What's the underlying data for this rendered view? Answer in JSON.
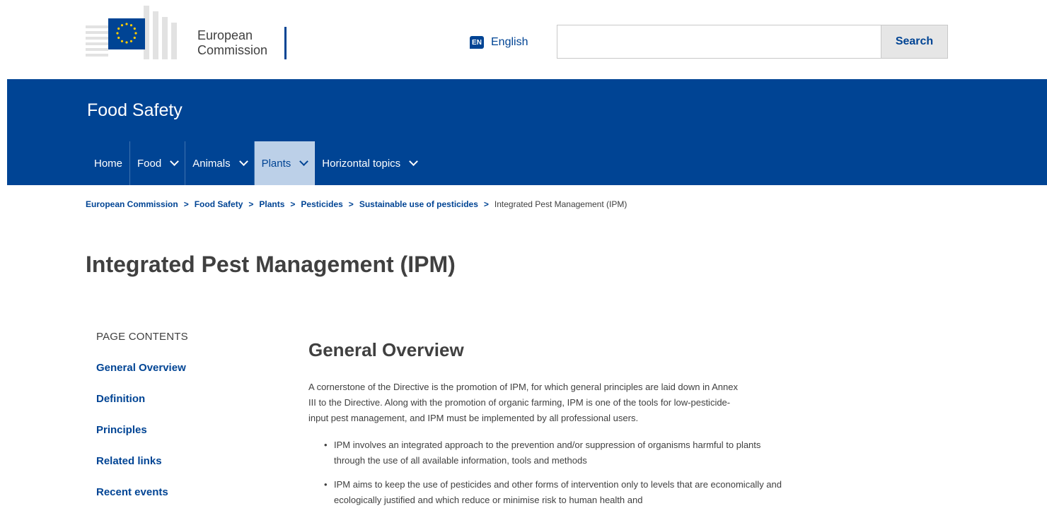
{
  "header": {
    "logo_line1": "European",
    "logo_line2": "Commission",
    "language_code": "EN",
    "language_label": "English",
    "search_value": "",
    "search_button": "Search"
  },
  "banner": {
    "site_title": "Food Safety",
    "nav": [
      {
        "label": "Home",
        "dropdown": false,
        "active": false
      },
      {
        "label": "Food",
        "dropdown": true,
        "active": false
      },
      {
        "label": "Animals",
        "dropdown": true,
        "active": false
      },
      {
        "label": "Plants",
        "dropdown": true,
        "active": true
      },
      {
        "label": "Horizontal topics",
        "dropdown": true,
        "active": false
      }
    ]
  },
  "breadcrumb": {
    "items": [
      "European Commission",
      "Food Safety",
      "Plants",
      "Pesticides",
      "Sustainable use of pesticides"
    ],
    "current": "Integrated Pest Management (IPM)"
  },
  "page_title": "Integrated Pest Management (IPM)",
  "sidebar": {
    "heading": "PAGE CONTENTS",
    "links": [
      "General Overview",
      "Definition",
      "Principles",
      "Related links",
      "Recent events"
    ]
  },
  "main": {
    "section_title": "General Overview",
    "intro": "A cornerstone of the Directive is the promotion of IPM, for which general principles are laid down in Annex III to the Directive. Along with the promotion of organic farming, IPM is one of the tools for low-pesticide-input pest management, and IPM must be implemented by all professional users.",
    "bullets": [
      "IPM involves an integrated approach to the prevention and/or suppression of organisms harmful to plants through the use of all available information, tools and methods",
      "IPM aims to keep the use of pesticides and other forms of intervention only to levels that are economically and ecologically justified and which reduce or minimise risk to human health and"
    ]
  },
  "colors": {
    "brand_blue": "#004494",
    "active_nav_bg": "#bcd0e8",
    "eu_yellow": "#ffcc00",
    "text": "#404040"
  },
  "icons": {
    "logo": "eu-flag-logo",
    "nav_dropdown": "chevron-down-icon",
    "breadcrumb_sep": "chevron-right-icon",
    "language": "language-badge-icon"
  }
}
